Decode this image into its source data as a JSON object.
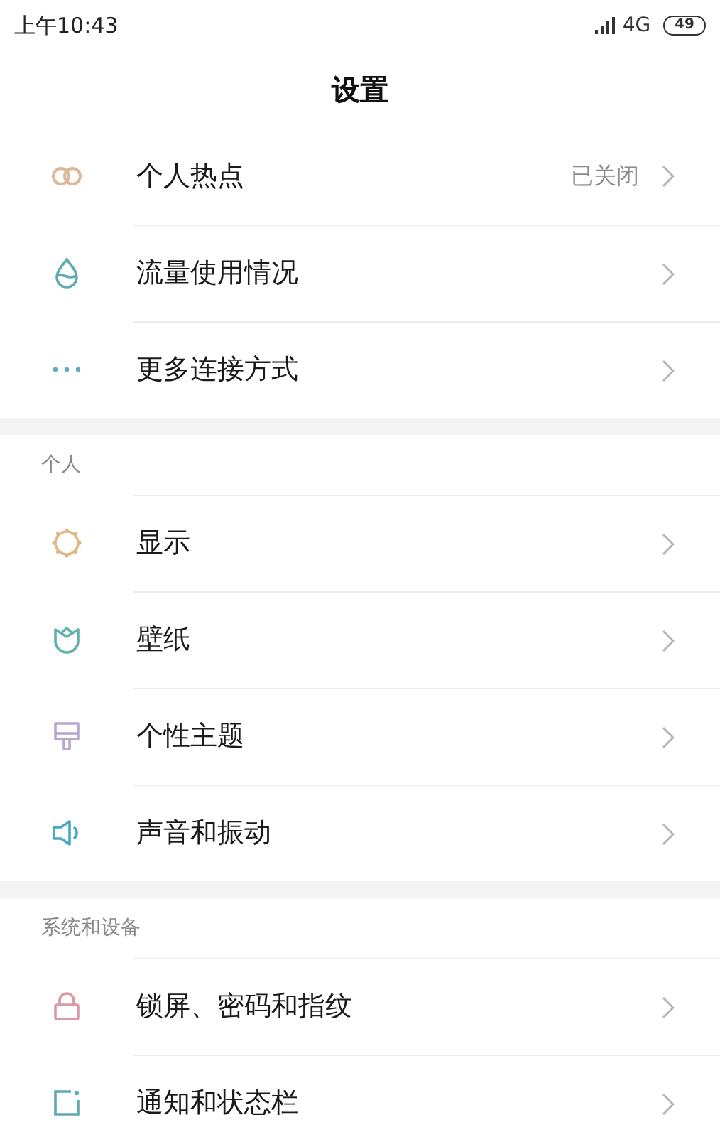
{
  "status_bar": {
    "time": "上午10:43",
    "network": "4G",
    "battery": "49"
  },
  "title": "设置",
  "sections": [
    {
      "items": [
        {
          "label": "个人热点",
          "value": "已关闭"
        },
        {
          "label": "流量使用情况"
        },
        {
          "label": "更多连接方式"
        }
      ]
    },
    {
      "header": "个人",
      "items": [
        {
          "label": "显示"
        },
        {
          "label": "壁纸"
        },
        {
          "label": "个性主题"
        },
        {
          "label": "声音和振动"
        }
      ]
    },
    {
      "header": "系统和设备",
      "items": [
        {
          "label": "锁屏、密码和指纹"
        },
        {
          "label": "通知和状态栏"
        }
      ]
    }
  ]
}
